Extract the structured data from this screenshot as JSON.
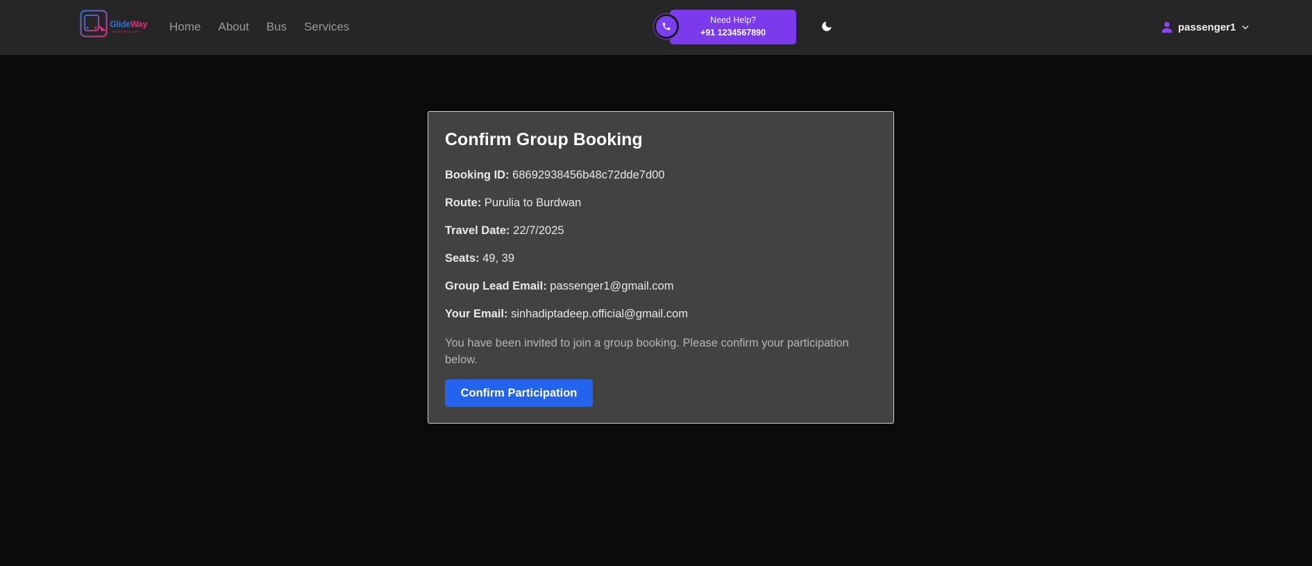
{
  "brand": {
    "name_part1": "Glide",
    "name_part2": "Way",
    "tagline": "TRAVEL WITH EASE"
  },
  "nav": {
    "items": [
      "Home",
      "About",
      "Bus",
      "Services"
    ]
  },
  "help": {
    "title": "Need Help?",
    "phone": "+91 1234567890"
  },
  "user": {
    "username": "passenger1"
  },
  "colors": {
    "accent": "#7b3aec",
    "primary_button": "#2463eb",
    "card_bg": "#424242",
    "navbar_bg": "#262626"
  },
  "icons": {
    "help": "phone-icon",
    "theme": "moon-icon",
    "user": "user-icon",
    "dropdown": "chevron-down-icon"
  },
  "booking": {
    "title": "Confirm Group Booking",
    "fields": [
      {
        "label": "Booking ID:",
        "value": "68692938456b48c72dde7d00"
      },
      {
        "label": "Route:",
        "value": "Purulia to Burdwan"
      },
      {
        "label": "Travel Date:",
        "value": "22/7/2025"
      },
      {
        "label": "Seats:",
        "value": "49, 39"
      },
      {
        "label": "Group Lead Email:",
        "value": "passenger1@gmail.com"
      },
      {
        "label": "Your Email:",
        "value": "sinhadiptadeep.official@gmail.com"
      }
    ],
    "note": "You have been invited to join a group booking. Please confirm your participation below.",
    "confirm_label": "Confirm Participation"
  }
}
